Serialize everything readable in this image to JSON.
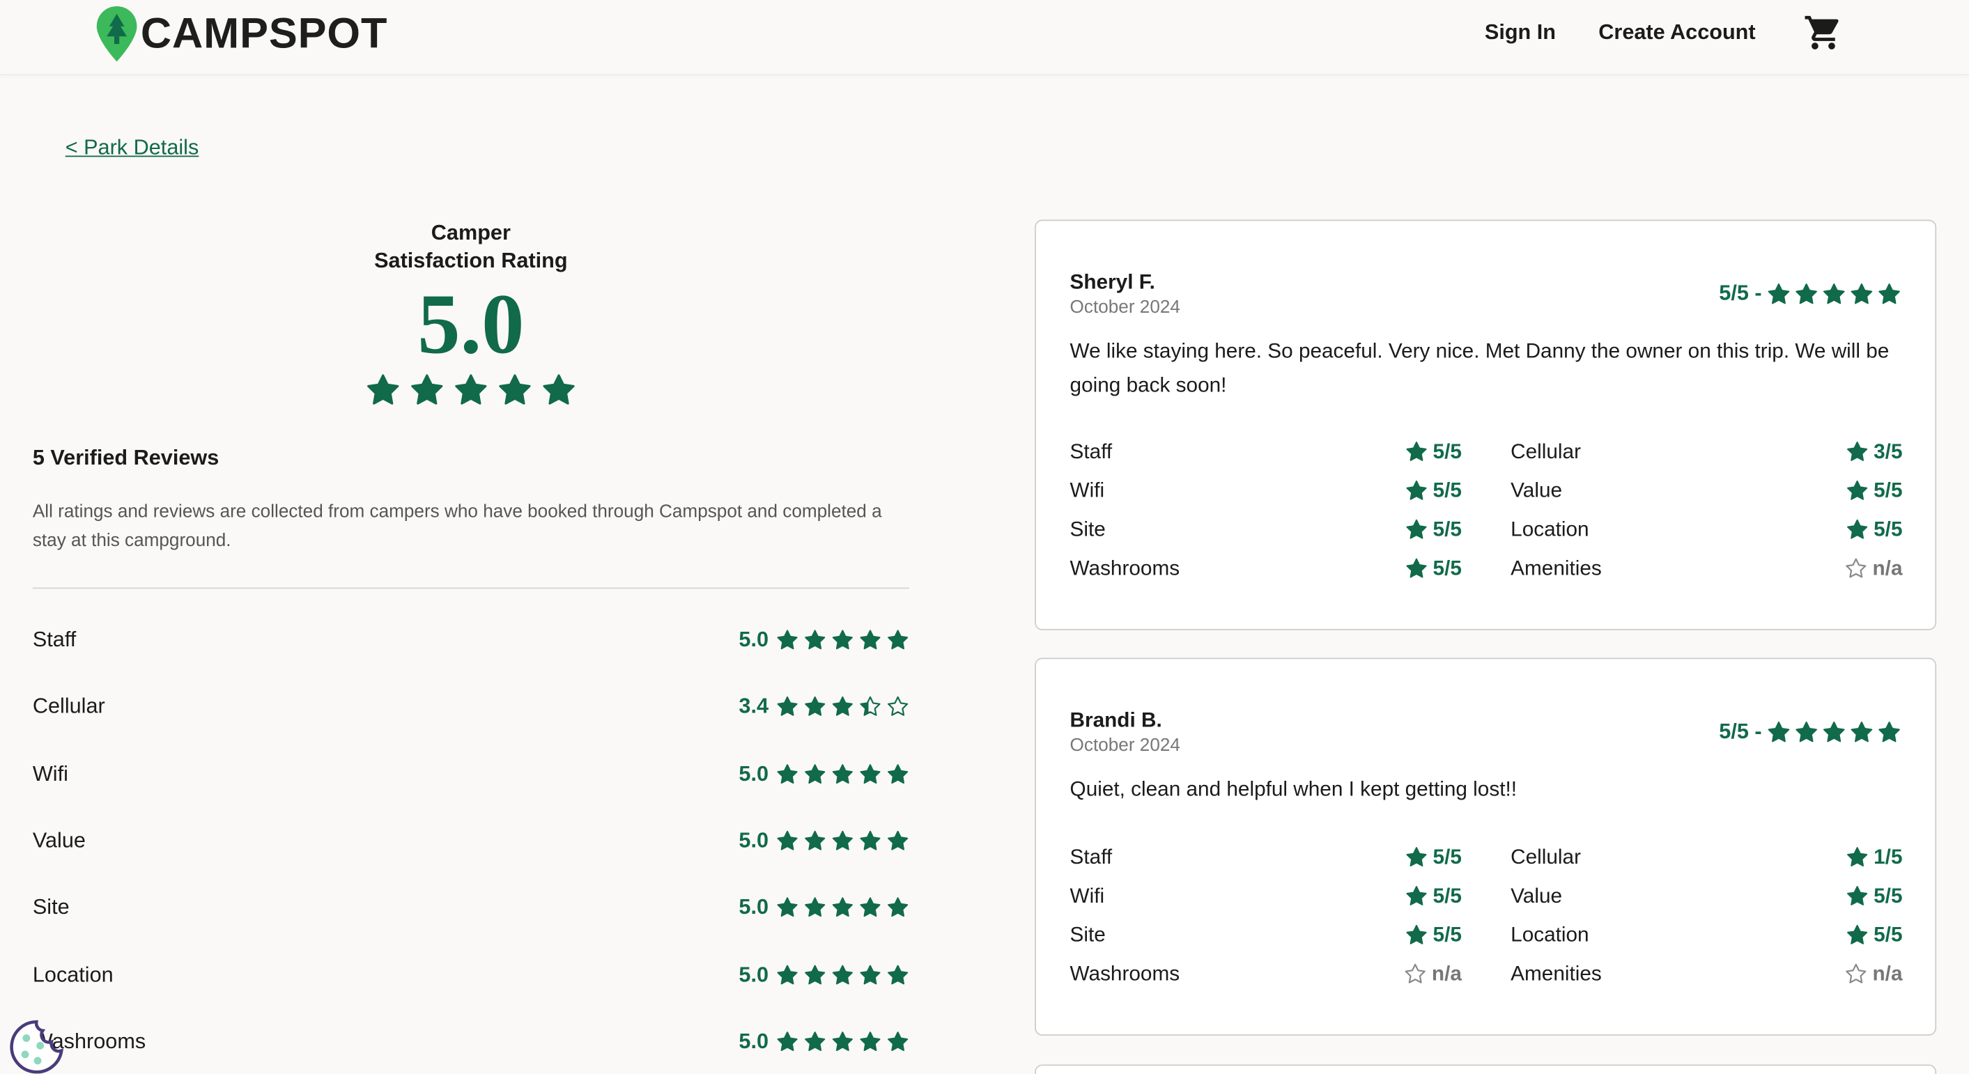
{
  "header": {
    "logo_text": "CAMPSPOT",
    "sign_in": "Sign In",
    "create_account": "Create Account",
    "brand_color": "#116a4a",
    "logo_green": "#3cb95a"
  },
  "back_link": "< Park Details",
  "summary": {
    "label_line1": "Camper",
    "label_line2": "Satisfaction Rating",
    "rating": "5.0",
    "stars": 5,
    "verified_reviews": "5 Verified Reviews",
    "disclaimer": "All ratings and reviews are collected from campers who have booked through Campspot and completed a stay at this campground."
  },
  "categories": [
    {
      "name": "Staff",
      "value": "5.0",
      "rating": 5.0
    },
    {
      "name": "Cellular",
      "value": "3.4",
      "rating": 3.4
    },
    {
      "name": "Wifi",
      "value": "5.0",
      "rating": 5.0
    },
    {
      "name": "Value",
      "value": "5.0",
      "rating": 5.0
    },
    {
      "name": "Site",
      "value": "5.0",
      "rating": 5.0
    },
    {
      "name": "Location",
      "value": "5.0",
      "rating": 5.0
    },
    {
      "name": "Washrooms",
      "value": "5.0",
      "rating": 5.0
    }
  ],
  "reviews": [
    {
      "name": "Sheryl F.",
      "date": "October 2024",
      "score": "5/5 -",
      "text": "We like staying here. So peaceful. Very nice. Met Danny the owner on this trip. We will be going back soon!",
      "ratings": [
        {
          "name": "Staff",
          "value": "5/5",
          "filled": true
        },
        {
          "name": "Cellular",
          "value": "3/5",
          "filled": true
        },
        {
          "name": "Wifi",
          "value": "5/5",
          "filled": true
        },
        {
          "name": "Value",
          "value": "5/5",
          "filled": true
        },
        {
          "name": "Site",
          "value": "5/5",
          "filled": true
        },
        {
          "name": "Location",
          "value": "5/5",
          "filled": true
        },
        {
          "name": "Washrooms",
          "value": "5/5",
          "filled": true
        },
        {
          "name": "Amenities",
          "value": "n/a",
          "filled": false
        }
      ]
    },
    {
      "name": "Brandi B.",
      "date": "October 2024",
      "score": "5/5 -",
      "text": "Quiet, clean and helpful when I kept getting lost!!",
      "ratings": [
        {
          "name": "Staff",
          "value": "5/5",
          "filled": true
        },
        {
          "name": "Cellular",
          "value": "1/5",
          "filled": true
        },
        {
          "name": "Wifi",
          "value": "5/5",
          "filled": true
        },
        {
          "name": "Value",
          "value": "5/5",
          "filled": true
        },
        {
          "name": "Site",
          "value": "5/5",
          "filled": true
        },
        {
          "name": "Location",
          "value": "5/5",
          "filled": true
        },
        {
          "name": "Washrooms",
          "value": "n/a",
          "filled": false
        },
        {
          "name": "Amenities",
          "value": "n/a",
          "filled": false
        }
      ]
    }
  ],
  "icons": {
    "cart": "cart-icon",
    "star": "star-icon",
    "cookie": "cookie-icon",
    "logo": "pine-tree-pin-icon"
  }
}
